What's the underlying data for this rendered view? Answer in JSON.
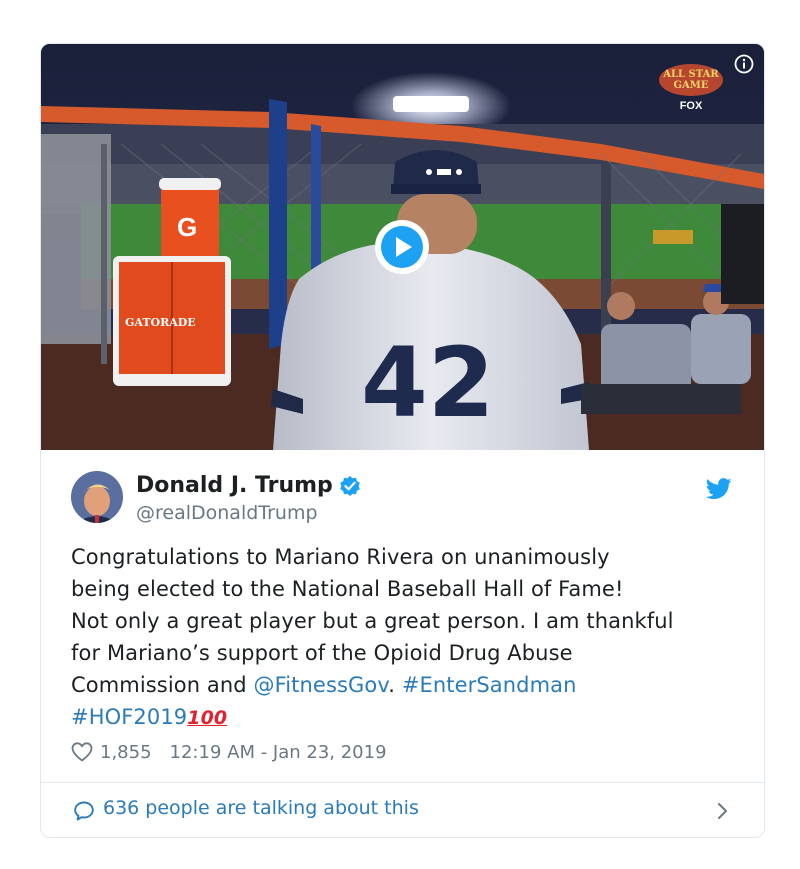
{
  "media": {
    "broadcast_logo_lines": [
      "ALL STAR",
      "GAME",
      "FOX"
    ],
    "sign_text": "GATORADE",
    "cooler_letter": "G",
    "jersey_number": "42",
    "icons": {
      "info": "info-icon",
      "play": "play-icon"
    }
  },
  "author": {
    "display_name": "Donald J. Trump",
    "handle": "@realDonaldTrump",
    "verified": true,
    "icons": {
      "verified": "verified-badge-icon",
      "platform": "twitter-bird-icon"
    }
  },
  "tweet": {
    "line1": "Congratulations to Mariano Rivera on unanimously",
    "line2": "being elected to the National Baseball Hall of Fame!",
    "line3": "Not only a great player but a great person. I am thankful",
    "line4": "for Mariano’s support of the Opioid Drug Abuse",
    "line5_prefix": "Commission and ",
    "mention": "@FitnessGov",
    "line5_sep": ". ",
    "hashtag1": "#EnterSandman",
    "hashtag2": "#HOF2019",
    "emoji": "100"
  },
  "meta": {
    "likes": "1,855",
    "timestamp": "12:19 AM - Jan 23, 2019",
    "icons": {
      "like": "heart-icon"
    }
  },
  "footer": {
    "talking_text": "636 people are talking about this",
    "icons": {
      "reply": "speech-bubble-icon",
      "more": "chevron-right-icon"
    }
  },
  "colors": {
    "link": "#2b7bb9",
    "text": "#1c2022",
    "muted": "#697882",
    "verified": "#1da1f2",
    "border": "#e1e8ed"
  }
}
